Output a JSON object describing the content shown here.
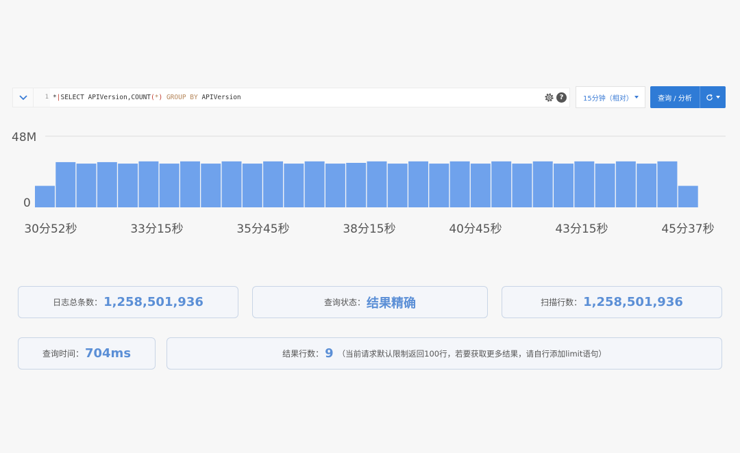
{
  "query": {
    "line_number": "1",
    "code": {
      "prefix": "*",
      "pipe": "|",
      "select_kw": "SELECT",
      "fields": " APIVersion,COUNT",
      "lparen": "(",
      "star": "*",
      "rparen": ")",
      "group_kw": " GROUP BY",
      "group_field": " APIVersion"
    },
    "icons": {
      "collapse": "chevron-down-icon",
      "settings": "gear-icon",
      "help": "help-icon",
      "refresh": "refresh-icon"
    },
    "help_label": "?",
    "time_range": "15分钟（相对）",
    "query_button": "查询 / 分析"
  },
  "colors": {
    "accent": "#2f7bd6",
    "bar": "#6fa2ec",
    "value": "#5b8fd6"
  },
  "chart_data": {
    "type": "bar",
    "yticks": [
      "48M",
      "0"
    ],
    "ylim": [
      0,
      48
    ],
    "grid": "top-line",
    "xticks": [
      "30分52秒",
      "33分15秒",
      "35分45秒",
      "38分15秒",
      "40分45秒",
      "43分15秒",
      "45分37秒"
    ],
    "values": [
      14.5,
      30.5,
      29.5,
      30.5,
      29.5,
      31,
      29.5,
      31,
      29.5,
      31,
      29.5,
      31,
      29.5,
      31,
      29.5,
      30,
      31,
      29.5,
      31,
      29.5,
      31,
      29.5,
      31,
      29.5,
      31,
      29.5,
      31,
      29.5,
      31,
      29.5,
      31,
      14.5
    ]
  },
  "stats": {
    "total_logs": {
      "label": "日志总条数：",
      "value": "1,258,501,936"
    },
    "status": {
      "label": "查询状态：",
      "value": "结果精确"
    },
    "scanned": {
      "label": "扫描行数：",
      "value": "1,258,501,936"
    },
    "time": {
      "label": "查询时间：",
      "value": "704ms"
    },
    "rows": {
      "label": "结果行数：",
      "value": "9",
      "note": "（当前请求默认限制返回100行，若要获取更多结果，请自行添加limit语句）"
    }
  }
}
